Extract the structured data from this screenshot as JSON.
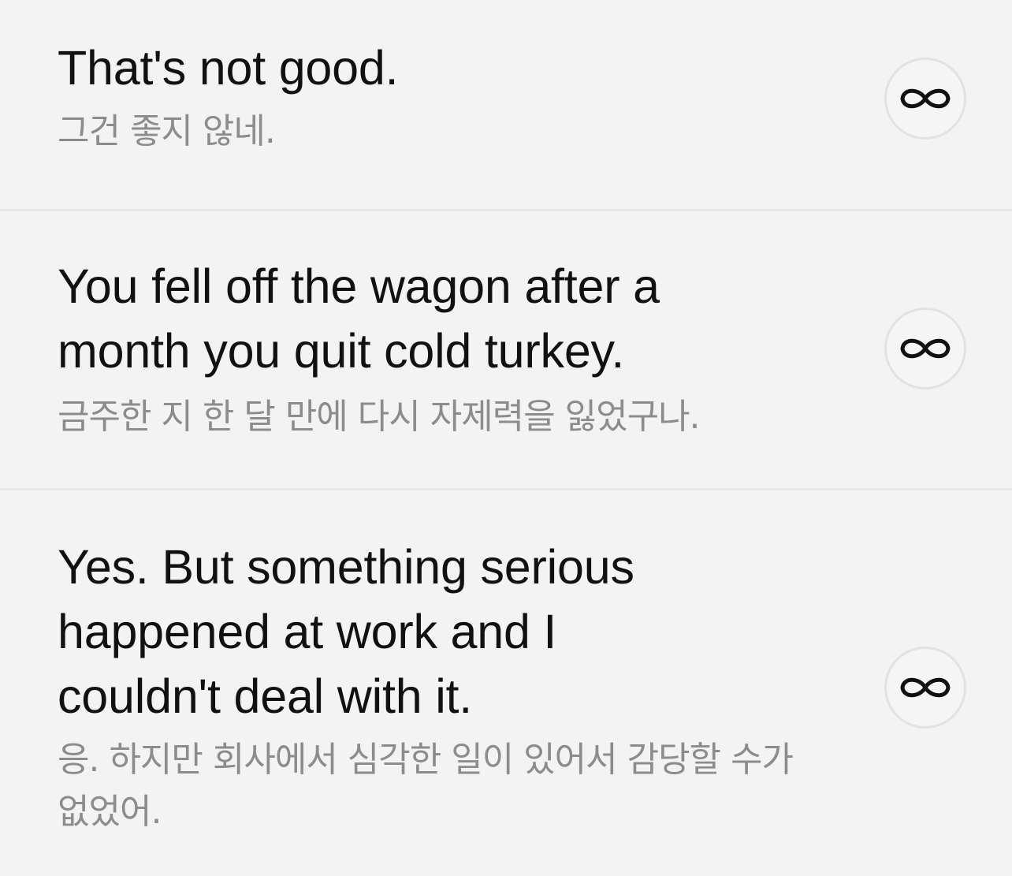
{
  "sentences": [
    {
      "english": "That's not good.",
      "korean": "그건 좋지 않네.",
      "button_icon": "infinity-icon"
    },
    {
      "english": "You fell off the wagon after a month you quit cold turkey.",
      "korean": "금주한 지 한 달 만에 다시 자제력을 잃었구나.",
      "button_icon": "infinity-icon"
    },
    {
      "english": "Yes. But something serious happened at work and I couldn't deal with it.",
      "korean": "응. 하지만 회사에서 심각한 일이 있어서 감당할 수가 없었어.",
      "button_icon": "infinity-icon"
    }
  ],
  "colors": {
    "background": "#f3f3f3",
    "divider": "#e6e6e6",
    "english_text": "#111111",
    "korean_text": "#8c8c8c",
    "button_border": "#e2e2e2",
    "icon": "#111111"
  }
}
